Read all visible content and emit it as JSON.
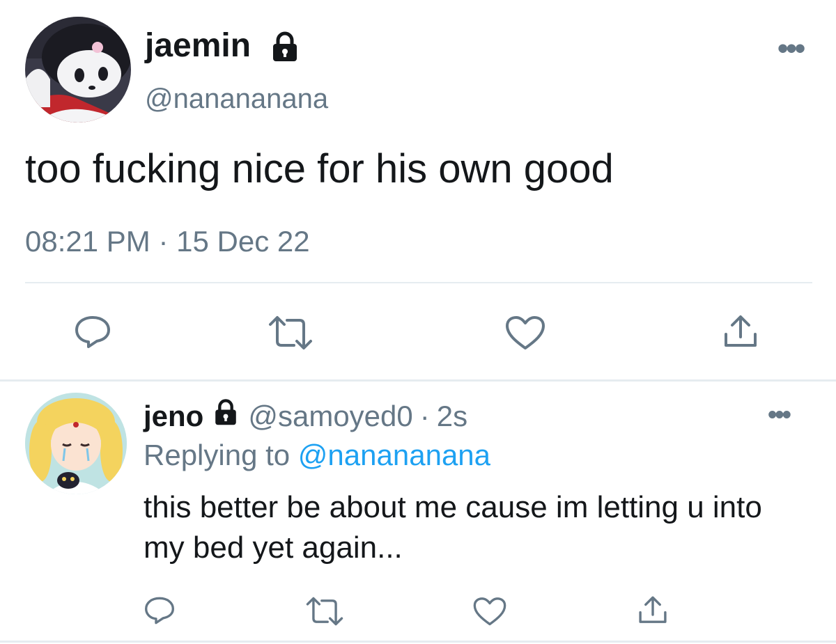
{
  "main_tweet": {
    "display_name": "jaemin",
    "handle": "@nanananana",
    "text": "too fucking nice for his own good",
    "time": "08:21 PM",
    "separator": "·",
    "date": "15 Dec 22",
    "more_label": "•••"
  },
  "reply": {
    "display_name": "jeno",
    "handle": "@samoyed0",
    "separator": "·",
    "time": "2s",
    "replying_prefix": "Replying to",
    "replying_to": "@nanananana",
    "text": "this better be about me cause im letting u into my bed yet again...",
    "more_label": "•••"
  },
  "icons": {
    "lock": "lock-icon",
    "reply": "comment-icon",
    "retweet": "retweet-icon",
    "like": "heart-icon",
    "share": "share-icon"
  },
  "colors": {
    "text": "#14171a",
    "secondary": "#657786",
    "link": "#1da1f2",
    "divider": "#e6ecf0"
  }
}
